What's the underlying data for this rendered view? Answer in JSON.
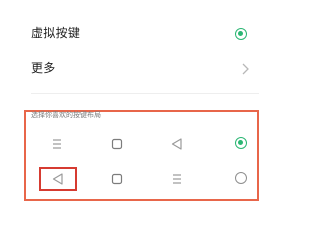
{
  "settings": {
    "virtual_keys": {
      "label": "虚拟按键",
      "enabled": true
    },
    "more": {
      "label": "更多"
    }
  },
  "layout_section": {
    "title": "选择你喜欢的按键布局",
    "options": [
      {
        "icons": [
          "menu-icon",
          "square-icon",
          "triangle-back-icon"
        ],
        "selected": true
      },
      {
        "icons": [
          "triangle-back-icon",
          "square-icon",
          "menu-icon"
        ],
        "selected": false
      }
    ]
  },
  "colors": {
    "accent": "#2bb673",
    "highlight_outer": "#e8664a",
    "highlight_inner": "#d63b31",
    "text_primary": "#1f1f1f",
    "text_secondary": "#7b7b7b",
    "icon_gray": "#9a9a9a"
  }
}
